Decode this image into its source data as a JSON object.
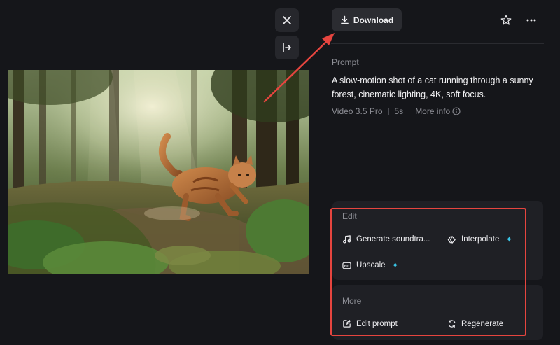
{
  "toolbar": {
    "download_label": "Download"
  },
  "prompt": {
    "label": "Prompt",
    "text": "A slow-motion shot of a cat running through a sunny forest, cinematic lighting, 4K, soft focus."
  },
  "meta": {
    "model": "Video 3.5 Pro",
    "duration": "5s",
    "more_info": "More info"
  },
  "edit_panel": {
    "title": "Edit",
    "actions": [
      {
        "label": "Generate soundtra...",
        "icon": "music-note-icon"
      },
      {
        "label": "Interpolate",
        "icon": "interpolate-icon",
        "badge": "sparkle"
      },
      {
        "label": "Upscale",
        "icon": "hd-icon",
        "badge": "sparkle"
      }
    ]
  },
  "more_panel": {
    "title": "More",
    "actions": [
      {
        "label": "Edit prompt",
        "icon": "edit-icon"
      },
      {
        "label": "Regenerate",
        "icon": "regenerate-icon"
      }
    ]
  },
  "colors": {
    "background": "#15161a",
    "panel": "#1f2025",
    "accent_sparkle": "#39c6e8",
    "annotation": "#e6453f"
  }
}
